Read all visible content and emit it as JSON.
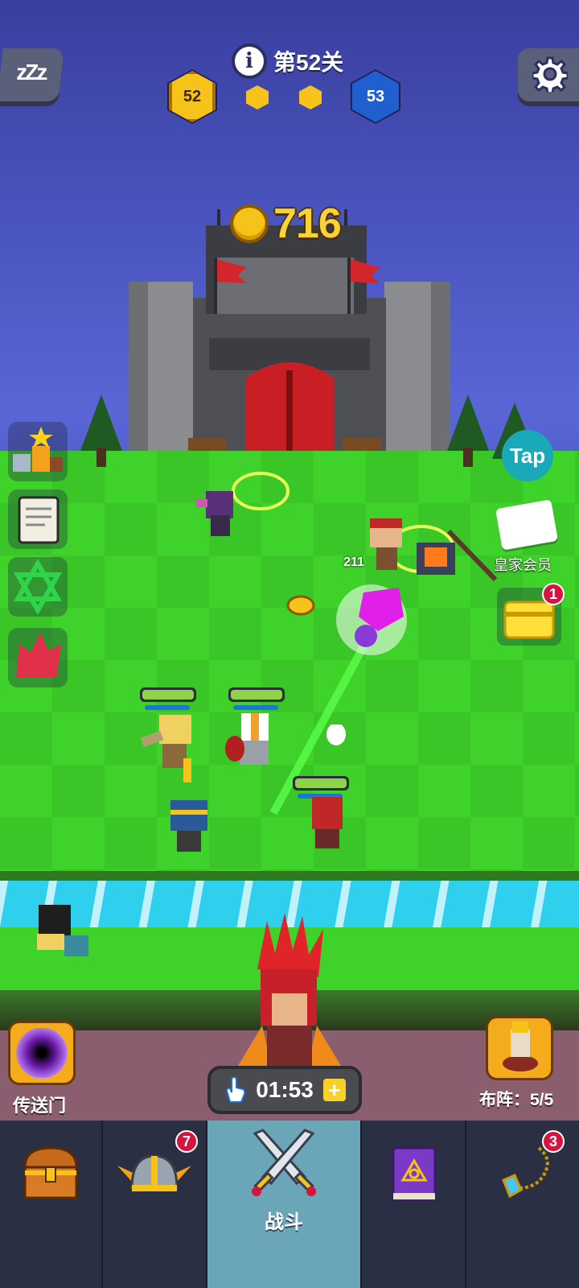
{
  "hud": {
    "level_text": "第52关",
    "current_level": "52",
    "next_level": "53",
    "coins": "716",
    "info_icon": "info-icon",
    "sleep_icon": "zzz-icon",
    "settings_icon": "gear-icon"
  },
  "side_left": [
    {
      "name": "ranking-icon"
    },
    {
      "name": "scroll-icon"
    },
    {
      "name": "hexagram-icon"
    },
    {
      "name": "red-leaf-icon"
    }
  ],
  "side_right": {
    "tap_label": "Tap",
    "royal_member_label": "皇家会员",
    "chest_badge": "1"
  },
  "battle": {
    "damage_text": "211"
  },
  "controls": {
    "portal_label": "传送门",
    "formation_label": "布阵：5/5",
    "timer": "01:53",
    "timer_plus": "+"
  },
  "navbar": {
    "items": [
      {
        "name": "treasure-chest",
        "label": "",
        "badge": ""
      },
      {
        "name": "heroes-helmet",
        "label": "",
        "badge": "7"
      },
      {
        "name": "battle",
        "label": "战斗",
        "badge": ""
      },
      {
        "name": "spellbook",
        "label": "",
        "badge": ""
      },
      {
        "name": "amulet",
        "label": "",
        "badge": "3"
      }
    ]
  },
  "colors": {
    "sky": "#4b55c0",
    "grass": "#3fd22a",
    "river": "#2fd0ee",
    "gold": "#f7c31b",
    "nav_active": "#6ba6b8",
    "badge": "#d3153f"
  }
}
